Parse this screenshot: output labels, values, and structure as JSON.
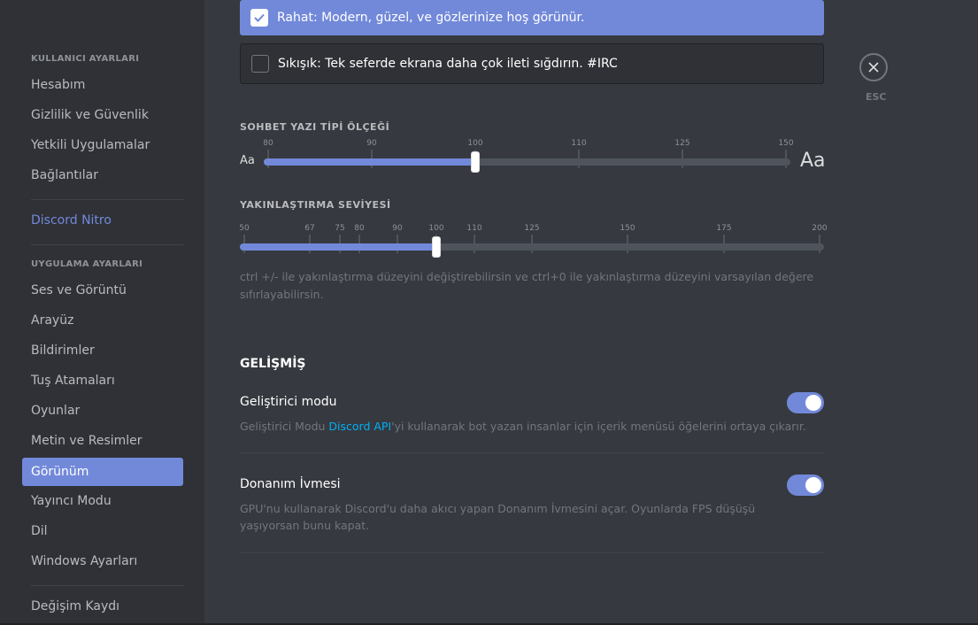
{
  "sidebar": {
    "user_header": "KULLANICI AYARLARI",
    "user_items": [
      "Hesabım",
      "Gizlilik ve Güvenlik",
      "Yetkili Uygulamalar",
      "Bağlantılar"
    ],
    "nitro": "Discord Nitro",
    "app_header": "UYGULAMA AYARLARI",
    "app_items": [
      "Ses ve Görüntü",
      "Arayüz",
      "Bildirimler",
      "Tuş Atamaları",
      "Oyunlar",
      "Metin ve Resimler",
      "Görünüm",
      "Yayıncı Modu",
      "Dil",
      "Windows Ayarları"
    ],
    "active_item": "Görünüm",
    "changelog": "Değişim Kaydı"
  },
  "display_mode": {
    "cozy": {
      "label": "Rahat: Modern, güzel, ve gözlerinize hoş görünür.",
      "checked": true
    },
    "compact": {
      "label": "Sıkışık: Tek seferde ekrana daha çok ileti sığdırın. #IRC",
      "checked": false
    }
  },
  "font_scale": {
    "title": "SOHBET YAZI TİPİ ÖLÇEĞİ",
    "ticks": [
      "80",
      "90",
      "100",
      "110",
      "125",
      "150"
    ],
    "value": 100,
    "small_label": "Aa",
    "big_label": "Aa"
  },
  "zoom": {
    "title": "YAKINLAŞTIRMA SEVİYESİ",
    "ticks": [
      "50",
      "67",
      "75",
      "80",
      "90",
      "100",
      "110",
      "125",
      "150",
      "175",
      "200"
    ],
    "value": 100,
    "hint": "ctrl +/- ile yakınlaştırma düzeyini değiştirebilirsin ve ctrl+0 ile yakınlaştırma düzeyini varsayılan değere sıfırlayabilirsin."
  },
  "advanced": {
    "title": "GELİŞMİŞ",
    "dev_mode": {
      "title": "Geliştirici modu",
      "desc_before": "Geliştirici Modu ",
      "desc_link": "Discord API",
      "desc_after": "'yi kullanarak bot yazan insanlar için içerik menüsü öğelerini ortaya çıkarır.",
      "enabled": true
    },
    "hw_accel": {
      "title": "Donanım İvmesi",
      "desc": "GPU'nu kullanarak Discord'u daha akıcı yapan Donanım İvmesini açar. Oyunlarda FPS düşüşü yaşıyorsan bunu kapat.",
      "enabled": true
    }
  },
  "close": {
    "label": "ESC",
    "icon": "close-icon"
  },
  "colors": {
    "accent": "#7289da",
    "link": "#00b0f4",
    "background": "#36393f",
    "sidebar": "#2f3136"
  }
}
